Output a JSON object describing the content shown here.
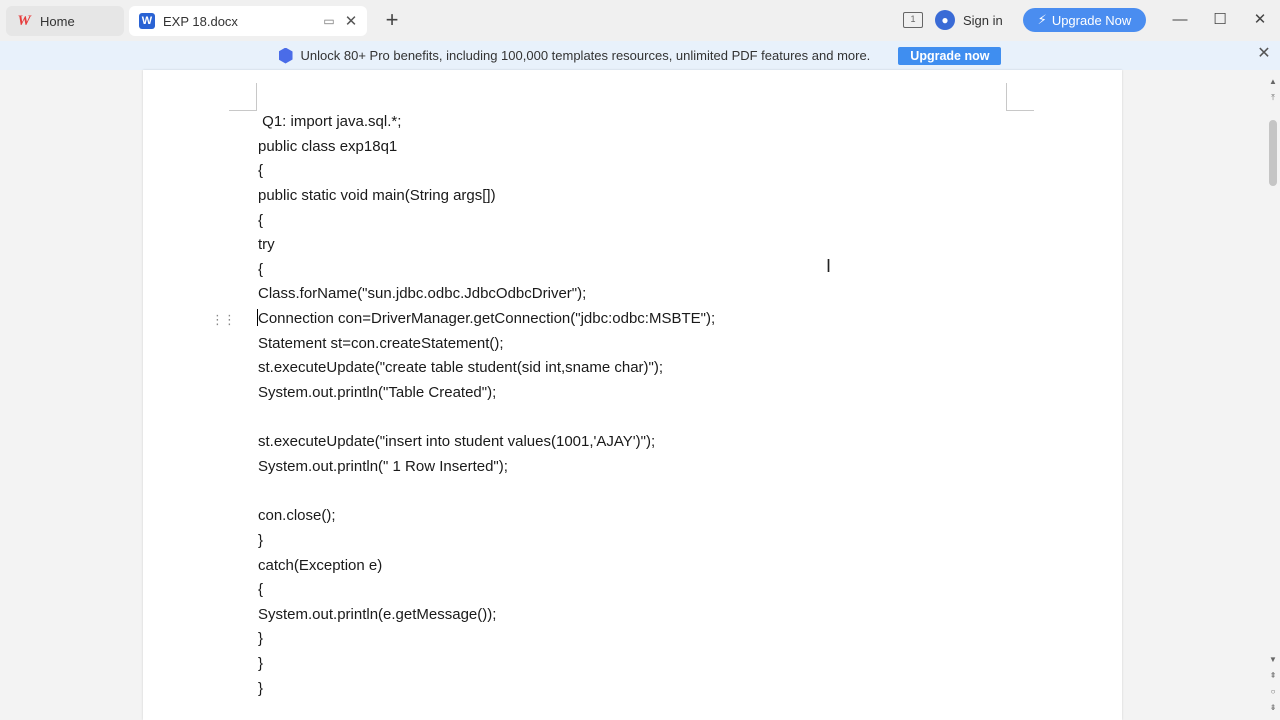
{
  "tabs": [
    {
      "label": "Home",
      "icon": "wps-logo-icon"
    },
    {
      "label": "EXP 18.docx",
      "icon": "word-doc-icon"
    }
  ],
  "titlebar": {
    "layout_badge": "1",
    "signin_label": "Sign in",
    "upgrade_label": "Upgrade Now"
  },
  "banner": {
    "text": "Unlock 80+ Pro benefits, including 100,000 templates resources, unlimited PDF features and more.",
    "button_label": "Upgrade now"
  },
  "document": {
    "lines": [
      " Q1: import java.sql.*;",
      "public class exp18q1",
      "{",
      "public static void main(String args[])",
      "{",
      "try",
      "{",
      "Class.forName(\"sun.jdbc.odbc.JdbcOdbcDriver\");",
      "Connection con=DriverManager.getConnection(\"jdbc:odbc:MSBTE\");",
      "Statement st=con.createStatement();",
      "st.executeUpdate(\"create table student(sid int,sname char)\");",
      "System.out.println(\"Table Created\");",
      "",
      "st.executeUpdate(\"insert into student values(1001,'AJAY')\");",
      "System.out.println(\" 1 Row Inserted\");",
      "",
      "con.close();",
      "}",
      "catch(Exception e)",
      "{",
      "System.out.println(e.getMessage());",
      "}",
      "}",
      "}"
    ]
  },
  "colors": {
    "accent": "#4a8df0",
    "banner_bg": "#e8f1fb",
    "spell_underline": "#e0455e"
  }
}
